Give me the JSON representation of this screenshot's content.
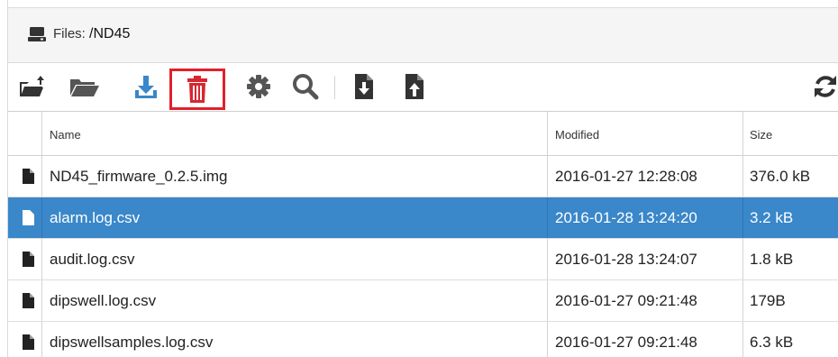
{
  "header": {
    "prefix": "Files: ",
    "path": "/ND45"
  },
  "toolbar": {
    "icons": [
      "upload-folder-icon",
      "open-folder-icon",
      "download-icon",
      "trash-icon",
      "gear-icon",
      "search-icon",
      "download-file-icon",
      "upload-file-icon",
      "refresh-icon"
    ],
    "highlight_color": "#e2202b",
    "download_color": "#3a87c9"
  },
  "table": {
    "columns": {
      "name": "Name",
      "modified": "Modified",
      "size": "Size"
    },
    "rows": [
      {
        "name": "ND45_firmware_0.2.5.img",
        "modified": "2016-01-27 12:28:08",
        "size": "376.0 kB",
        "selected": false
      },
      {
        "name": "alarm.log.csv",
        "modified": "2016-01-28 13:24:20",
        "size": "3.2 kB",
        "selected": true
      },
      {
        "name": "audit.log.csv",
        "modified": "2016-01-28 13:24:07",
        "size": "1.8 kB",
        "selected": false
      },
      {
        "name": "dipswell.log.csv",
        "modified": "2016-01-27 09:21:48",
        "size": "179B",
        "selected": false
      },
      {
        "name": "dipswellsamples.log.csv",
        "modified": "2016-01-27 09:21:48",
        "size": "6.3 kB",
        "selected": false
      }
    ],
    "selection_color": "#3a87c9"
  }
}
